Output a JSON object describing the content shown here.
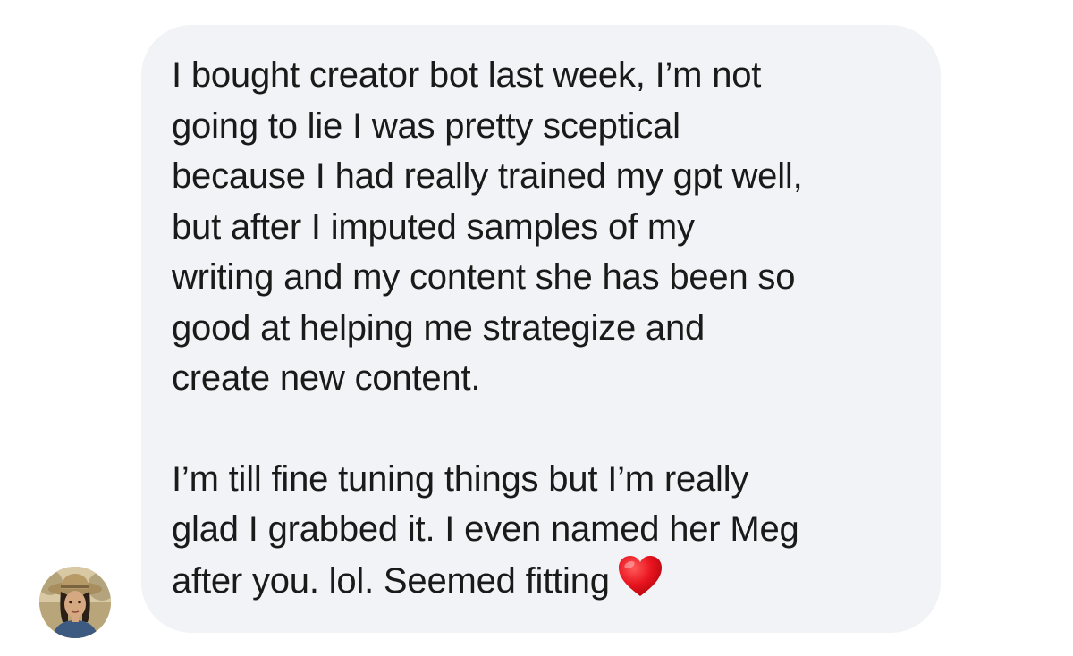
{
  "message": {
    "paragraph1": [
      "I bought creator bot last week, I’m not",
      "going to lie I was pretty sceptical",
      "because I had really trained my gpt well,",
      "but after I imputed samples of my",
      "writing and my content she has been so",
      "good at helping me strategize and",
      "create new content."
    ],
    "paragraph2": [
      "I’m till fine tuning things but I’m really",
      "glad I grabbed it. I even named her Meg",
      "after you. lol. Seemed fitting"
    ],
    "trailing_icon": "red-heart-emoji",
    "bubble_color": "#f2f3f6",
    "text_color": "#1a1a1a"
  },
  "sender": {
    "avatar_icon": "profile-photo"
  }
}
